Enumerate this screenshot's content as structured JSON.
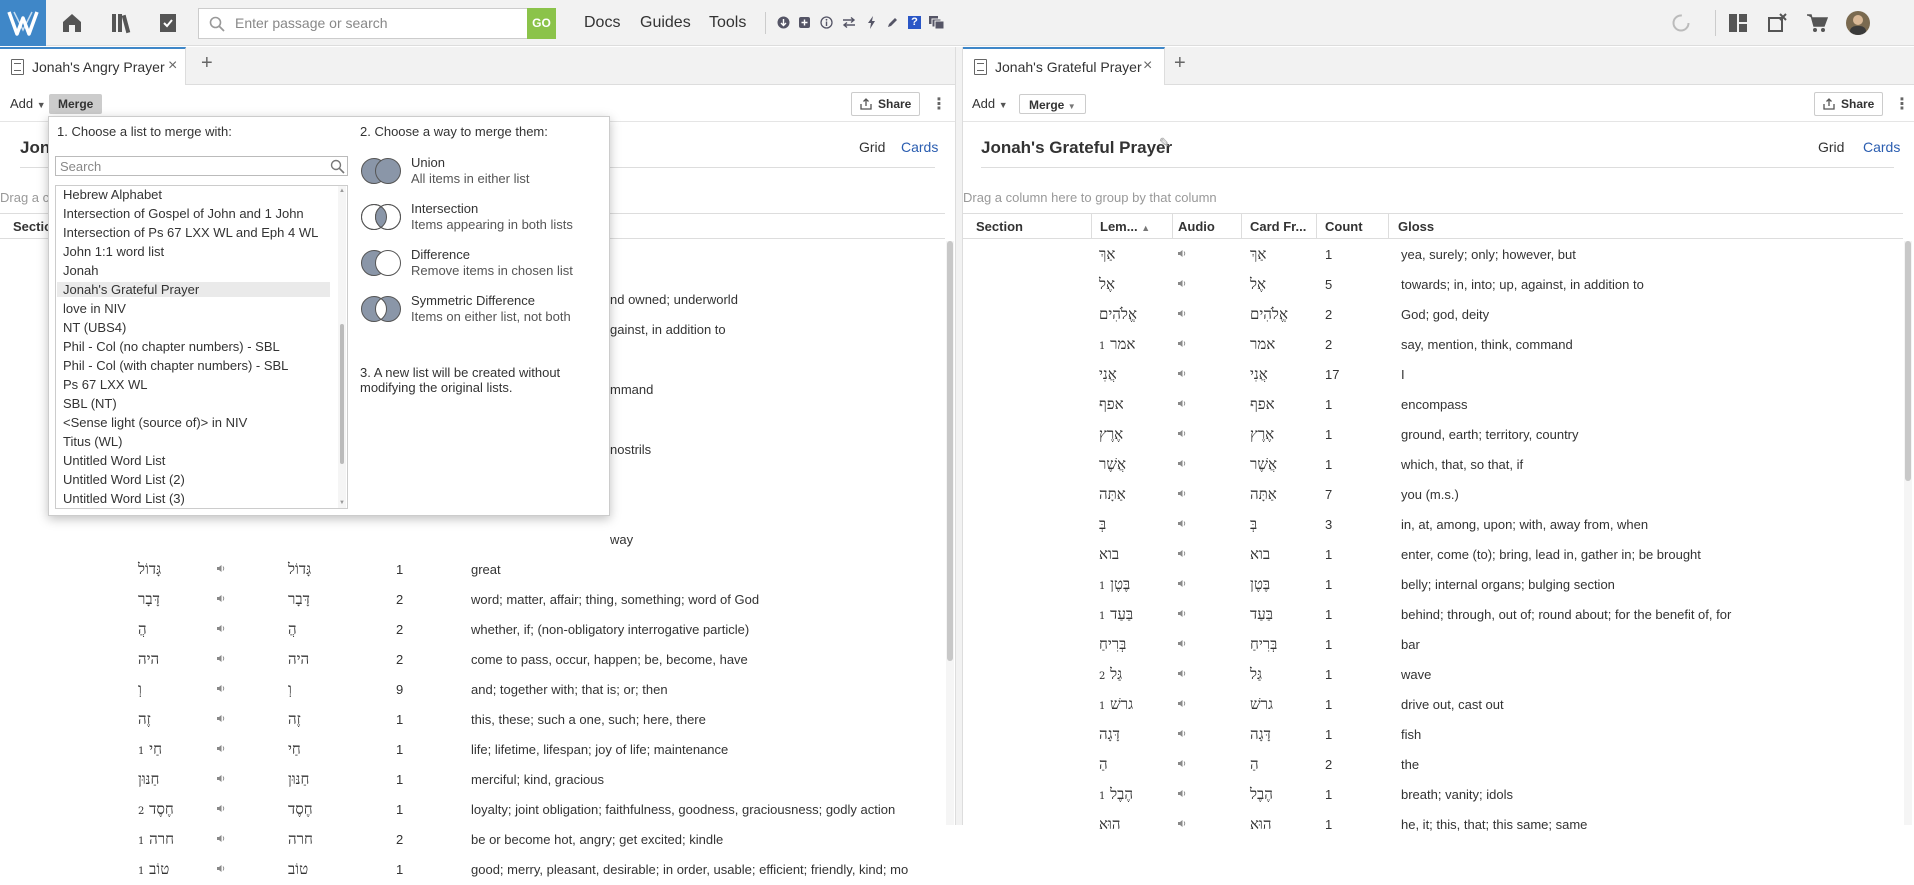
{
  "topbar": {
    "search_placeholder": "Enter passage or search",
    "go_label": "GO",
    "nav": [
      "Docs",
      "Guides",
      "Tools"
    ],
    "tools_help": "?"
  },
  "left": {
    "tab_title": "Jonah's Angry Prayer",
    "toolbar": {
      "add": "Add",
      "merge": "Merge",
      "share": "Share"
    },
    "title_prefix": "Jon",
    "view": {
      "grid": "Grid",
      "cards": "Cards"
    },
    "group_hint": "Drag a c",
    "header": {
      "section": "Sectio"
    },
    "partial_glosses": [
      {
        "gloss": "nd owned; underworld"
      },
      {
        "gloss": "gainst, in addition to"
      },
      {
        "gloss": "mmand"
      },
      {
        "gloss": "nostrils"
      },
      {
        "gloss": "way"
      }
    ],
    "rows": [
      {
        "lemma": "גָּדוֹל",
        "hom": "",
        "form": "גָּדוֹל",
        "count": "1",
        "gloss": "great"
      },
      {
        "lemma": "דָּבָר",
        "hom": "",
        "form": "דָּבָר",
        "count": "2",
        "gloss": "word; matter, affair; thing, something; word of God"
      },
      {
        "lemma": "הֲ",
        "hom": "",
        "form": "הֲ",
        "count": "2",
        "gloss": "whether, if; (non-obligatory interrogative particle)"
      },
      {
        "lemma": "היה",
        "hom": "",
        "form": "היה",
        "count": "2",
        "gloss": "come to pass, occur, happen; be, become, have"
      },
      {
        "lemma": "וְ",
        "hom": "",
        "form": "וְ",
        "count": "9",
        "gloss": "and; together with; that is; or; then"
      },
      {
        "lemma": "זֶה",
        "hom": "",
        "form": "זֶה",
        "count": "1",
        "gloss": "this, these; such a one, such; here, there"
      },
      {
        "lemma": "חַי",
        "hom": "1",
        "form": "חַי",
        "count": "1",
        "gloss": "life; lifetime, lifespan; joy of life; maintenance"
      },
      {
        "lemma": "חַנּוּן",
        "hom": "",
        "form": "חַנּוּן",
        "count": "1",
        "gloss": "merciful; kind, gracious"
      },
      {
        "lemma": "חֶסֶד",
        "hom": "2",
        "form": "חֶסֶד",
        "count": "1",
        "gloss": "loyalty; joint obligation; faithfulness, goodness, graciousness; godly action"
      },
      {
        "lemma": "חרה",
        "hom": "1",
        "form": "חרה",
        "count": "2",
        "gloss": "be or become hot, angry; get excited; kindle"
      },
      {
        "lemma": "טוֹב",
        "hom": "1",
        "form": "טוֹב",
        "count": "1",
        "gloss": "good; merry, pleasant, desirable; in order, usable; efficient; friendly, kind; mo"
      }
    ]
  },
  "right": {
    "tab_title": "Jonah's Grateful Prayer",
    "toolbar": {
      "add": "Add",
      "merge": "Merge",
      "share": "Share"
    },
    "title": "Jonah's Grateful Prayer",
    "view": {
      "grid": "Grid",
      "cards": "Cards"
    },
    "group_hint": "Drag a column here to group by that column",
    "header": {
      "section": "Section",
      "lemma": "Lem...",
      "audio": "Audio",
      "card_form": "Card Fr...",
      "count": "Count",
      "gloss": "Gloss"
    },
    "rows": [
      {
        "lemma": "אַךְ",
        "hom": "",
        "form": "אַךְ",
        "count": "1",
        "gloss": "yea, surely; only; however, but"
      },
      {
        "lemma": "אֶל",
        "hom": "",
        "form": "אֶל",
        "count": "5",
        "gloss": "towards; in, into; up, against, in addition to"
      },
      {
        "lemma": "אֱלֹהִים",
        "hom": "",
        "form": "אֱלֹהִים",
        "count": "2",
        "gloss": "God; god, deity"
      },
      {
        "lemma": "אמר",
        "hom": "1",
        "form": "אמר",
        "count": "2",
        "gloss": "say, mention, think, command"
      },
      {
        "lemma": "אֲנִי",
        "hom": "",
        "form": "אֲנִי",
        "count": "17",
        "gloss": "I"
      },
      {
        "lemma": "אפף",
        "hom": "",
        "form": "אפף",
        "count": "1",
        "gloss": "encompass"
      },
      {
        "lemma": "אֶרֶץ",
        "hom": "",
        "form": "אֶרֶץ",
        "count": "1",
        "gloss": "ground, earth; territory, country"
      },
      {
        "lemma": "אֲשֶׁר",
        "hom": "",
        "form": "אֲשֶׁר",
        "count": "1",
        "gloss": "which, that, so that, if"
      },
      {
        "lemma": "אַתָּה",
        "hom": "",
        "form": "אַתָּה",
        "count": "7",
        "gloss": "you (m.s.)"
      },
      {
        "lemma": "בְּ",
        "hom": "",
        "form": "בְּ",
        "count": "3",
        "gloss": "in, at, among, upon; with, away from, when"
      },
      {
        "lemma": "בוא",
        "hom": "",
        "form": "בוא",
        "count": "1",
        "gloss": "enter, come (to); bring, lead in, gather in; be brought"
      },
      {
        "lemma": "בֶּטֶן",
        "hom": "1",
        "form": "בֶּטֶן",
        "count": "1",
        "gloss": "belly; internal organs; bulging section"
      },
      {
        "lemma": "בַּעַד",
        "hom": "1",
        "form": "בַּעַד",
        "count": "1",
        "gloss": "behind; through, out of; round about; for the benefit of, for"
      },
      {
        "lemma": "בְּרִיחַ",
        "hom": "",
        "form": "בְּרִיחַ",
        "count": "1",
        "gloss": "bar"
      },
      {
        "lemma": "גַּל",
        "hom": "2",
        "form": "גַּל",
        "count": "1",
        "gloss": "wave"
      },
      {
        "lemma": "גרשׁ",
        "hom": "1",
        "form": "גרשׁ",
        "count": "1",
        "gloss": "drive out, cast out"
      },
      {
        "lemma": "דָּגָה",
        "hom": "",
        "form": "דָּגָה",
        "count": "1",
        "gloss": "fish"
      },
      {
        "lemma": "הַ",
        "hom": "",
        "form": "הַ",
        "count": "2",
        "gloss": "the"
      },
      {
        "lemma": "הֶבֶל",
        "hom": "1",
        "form": "הֶבֶל",
        "count": "1",
        "gloss": "breath; vanity; idols"
      },
      {
        "lemma": "הוּא",
        "hom": "",
        "form": "הוּא",
        "count": "1",
        "gloss": "he, it; this, that; this same; same"
      }
    ]
  },
  "popup": {
    "step1": "1. Choose a list to merge with:",
    "search_placeholder": "Search",
    "lists": [
      "Hebrew Alphabet",
      "Intersection of Gospel of John and 1 John",
      "Intersection of Ps 67 LXX WL and Eph 4 WL",
      "John 1:1 word list",
      "Jonah",
      "Jonah's Grateful Prayer",
      "love in NIV",
      "NT (UBS4)",
      "Phil - Col (no chapter numbers) - SBL",
      "Phil - Col (with chapter numbers) - SBL",
      "Ps 67 LXX WL",
      "SBL (NT)",
      "<Sense light (source of)> in NIV",
      "Titus (WL)",
      "Untitled Word List",
      "Untitled Word List (2)",
      "Untitled Word List (3)"
    ],
    "selected_index": 5,
    "step2": "2. Choose a way to merge them:",
    "options": [
      {
        "title": "Union",
        "desc": "All items in either list"
      },
      {
        "title": "Intersection",
        "desc": "Items appearing in both lists"
      },
      {
        "title": "Difference",
        "desc": "Remove items in chosen list"
      },
      {
        "title": "Symmetric Difference",
        "desc": "Items on either list, not both"
      }
    ],
    "step3": "3. A new list will be created without modifying the original lists."
  },
  "colors": {
    "accent": "#3f87c8",
    "go": "#8bc34a",
    "venn_fill": "#8a96a8"
  }
}
